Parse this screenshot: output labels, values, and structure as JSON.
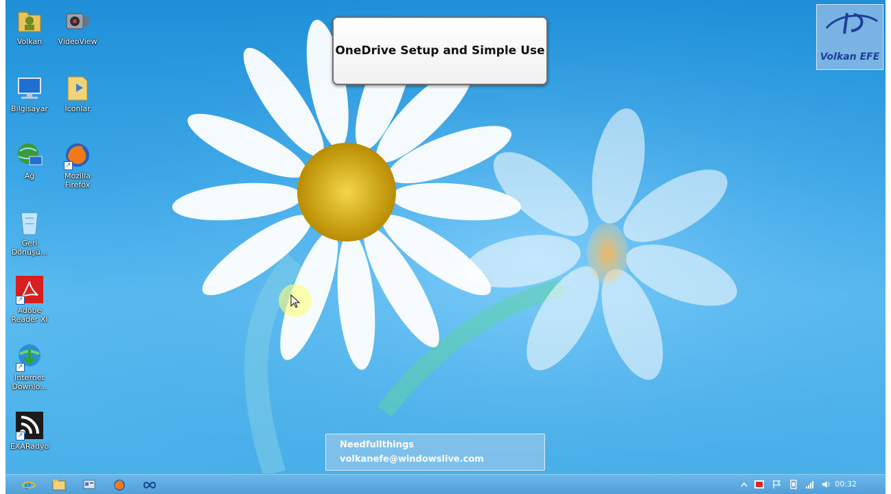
{
  "desktop_icons": [
    {
      "label": "Volkan"
    },
    {
      "label": "VideoView"
    },
    {
      "label": "Bilgisayar"
    },
    {
      "label": "İconlar"
    },
    {
      "label": "Ağ"
    },
    {
      "label": "Mozilla Firefox"
    },
    {
      "label": "Geri Dönüşü..."
    },
    {
      "label": "Adobe Reader XI"
    },
    {
      "label": "Internet Downlo..."
    },
    {
      "label": "EXARadyo"
    }
  ],
  "title_box": {
    "text": "OneDrive Setup and Simple Use"
  },
  "logo": {
    "text": "Volkan EFE"
  },
  "caption": {
    "line1": "Needfullthings",
    "line2": "volkanefe@windowslive.com"
  },
  "taskbar": {
    "buttons": [
      "internet-explorer",
      "file-explorer",
      "control-panel",
      "firefox",
      "link-app"
    ],
    "clock": "00:32"
  },
  "colors": {
    "sky": "#3aa6e6",
    "taskbar": "#5aa9df",
    "flower_center": "#e0b800"
  }
}
